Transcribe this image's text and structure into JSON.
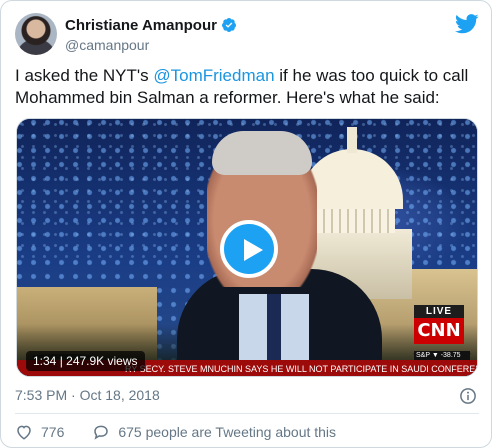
{
  "user": {
    "name": "Christiane Amanpour",
    "handle": "@camanpour"
  },
  "tweet": {
    "text_prefix": "I asked the NYT's ",
    "mention": "@TomFriedman",
    "text_suffix": " if he was too quick to call Mohammed bin Salman a reformer. Here's what he said:"
  },
  "media": {
    "duration_views": "1:34 | 247.9K views",
    "live_label": "LIVE",
    "network": "CNN",
    "ticker_small": "S&P  ▼ -38.75",
    "ticker_text": "RY SECY. STEVE MNUCHIN SAYS HE WILL NOT PARTICIPATE IN SAUDI CONFERENCE"
  },
  "meta": {
    "timestamp": "7:53 PM · Oct 18, 2018"
  },
  "actions": {
    "likes": "776",
    "conversation": "675 people are Tweeting about this"
  },
  "colors": {
    "accent": "#1da1f2",
    "link": "#1b95e0",
    "muted": "#657786",
    "cnn_red": "#cc0000"
  },
  "icons": {
    "verified": "verified-badge-icon",
    "brand": "twitter-bird-icon",
    "play": "play-icon",
    "info": "info-icon",
    "like": "heart-icon",
    "conversation": "speech-bubble-icon"
  }
}
